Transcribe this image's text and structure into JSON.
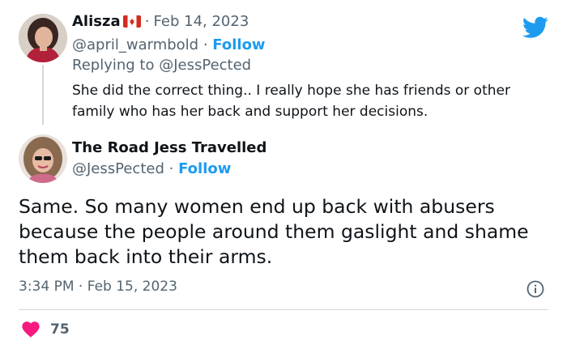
{
  "parent_tweet": {
    "author_name": "Alisza",
    "flag": "canada-flag",
    "separator": "·",
    "date": "Feb 14, 2023",
    "handle": "@april_warmbold",
    "follow_label": "Follow",
    "replying_prefix": "Replying to",
    "replying_to": "@JessPected",
    "text": "She did the correct thing.. I really hope she has friends or other family who has her back and support her decisions."
  },
  "main_tweet": {
    "author_name": "The Road Jess Travelled",
    "handle": "@JessPected",
    "follow_label": "Follow",
    "text": "Same. So many women end up back with abusers because the people around them gaslight and shame them back into their arms.",
    "time": "3:34 PM",
    "date": "Feb 15, 2023",
    "likes": "75"
  },
  "icons": {
    "brand": "twitter-bird-icon",
    "info": "info-icon",
    "like": "heart-icon"
  },
  "colors": {
    "accent": "#1d9bf0",
    "like": "#f91880",
    "muted_text": "#536471",
    "text": "#0f1419",
    "flag_red": "#d52b1e"
  }
}
